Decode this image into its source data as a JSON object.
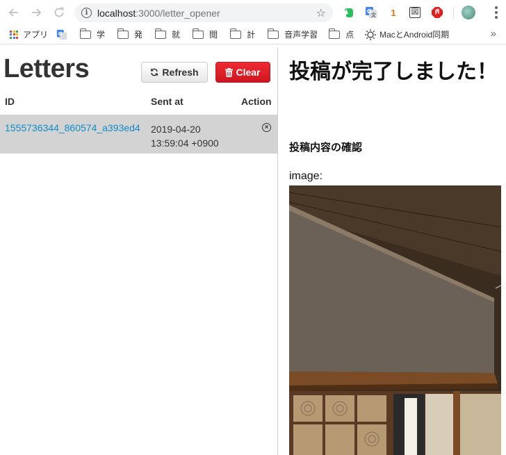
{
  "browser": {
    "url_host": "localhost",
    "url_path": ":3000/letter_opener",
    "extensions": [
      "evernote-icon",
      "translate-icon",
      "1",
      "図",
      "adblock-icon"
    ],
    "bookmarks": [
      {
        "label": "アプリ",
        "icon": "apps-grid-icon"
      },
      {
        "label": "",
        "icon": "google-translate-icon"
      },
      {
        "label": "学",
        "icon": "folder-icon"
      },
      {
        "label": "発",
        "icon": "folder-icon"
      },
      {
        "label": "就",
        "icon": "folder-icon"
      },
      {
        "label": "閲",
        "icon": "folder-icon"
      },
      {
        "label": "計",
        "icon": "folder-icon"
      },
      {
        "label": "音声学習",
        "icon": "folder-icon"
      },
      {
        "label": "点",
        "icon": "folder-icon"
      },
      {
        "label": "MacとAndroid同期",
        "icon": "sun-icon"
      }
    ],
    "more": "»"
  },
  "letters": {
    "title": "Letters",
    "refresh_label": "Refresh",
    "clear_label": "Clear",
    "columns": {
      "id": "ID",
      "sent_at": "Sent at",
      "action": "Action"
    },
    "rows": [
      {
        "id": "1555736344_860574_a393ed4",
        "sent_line1": "2019-04-20",
        "sent_line2": "13:59:04 +0900"
      }
    ]
  },
  "message": {
    "heading": "投稿が完了しました！",
    "subheading": "投稿内容の確認",
    "image_label": "image:"
  },
  "colors": {
    "link": "#0e8cc8",
    "clear_button": "#dc1e29",
    "selected_row": "#d3d3d3"
  }
}
